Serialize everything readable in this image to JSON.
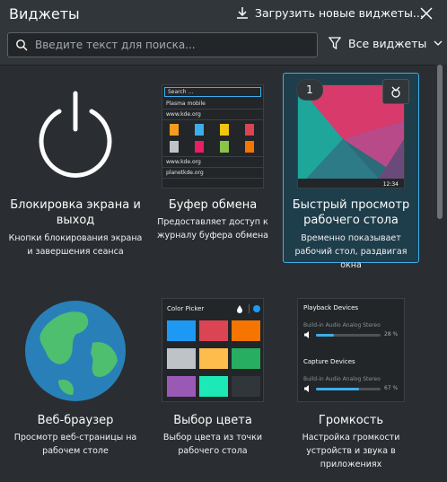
{
  "header": {
    "title": "Виджеты",
    "download_label": "Загрузить новые виджеты...",
    "search_placeholder": "Введите текст для поиска...",
    "filter_label": "Все виджеты"
  },
  "widgets": [
    {
      "name": "Блокировка экрана и выход",
      "description": "Кнопки блокирования экрана и завершения сеанса"
    },
    {
      "name": "Буфер обмена",
      "description": "Предоставляет доступ к журналу буфера обмена",
      "preview": {
        "search": "Search ...",
        "item1": "Plasma mobile",
        "item2": "www.kde.org",
        "item3": "www.kde.org",
        "item4": "planetkde.org"
      }
    },
    {
      "name": "Быстрый просмотр рабочего стола",
      "description": "Временно показывает рабочий стол, раздвигая окна",
      "badge": "1",
      "time": "12:34"
    },
    {
      "name": "Веб-браузер",
      "description": "Просмотр веб-страницы на рабочем столе"
    },
    {
      "name": "Выбор цвета",
      "description": "Выбор цвета из точки рабочего стола",
      "preview": {
        "title": "Color Picker"
      }
    },
    {
      "name": "Громкость",
      "description": "Настройка громкости устройств и звука в приложениях",
      "preview": {
        "playback_title": "Playback Devices",
        "playback_device": "Build-in Audio Analog Stereo",
        "playback_pct": "28 %",
        "playback_level": 0.28,
        "capture_title": "Capture Devices",
        "capture_device": "Build-in Audio Analog Stereo",
        "capture_pct": "67 %",
        "capture_level": 0.67
      }
    }
  ],
  "colors": {
    "accent": "#3daee9",
    "background": "#2a2e32",
    "selected_bg": "#1f3e4b"
  },
  "swatches": [
    "#1d99f3",
    "#da4453",
    "#f67400",
    "#bdc3c7",
    "#fdbc4b",
    "#27ae60",
    "#9b59b6",
    "#1de9b6",
    "#31363b"
  ]
}
